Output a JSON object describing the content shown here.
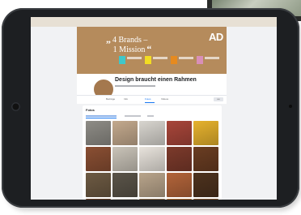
{
  "cover": {
    "quote_open": "„",
    "quote_close": "“",
    "line1": "4 Brands –",
    "line2": "1 Mission",
    "logo": "AD",
    "tiles": [
      {
        "color": "#3fc7c9"
      },
      {
        "color": "#f2dc22"
      },
      {
        "color": "#e68a1f"
      },
      {
        "color": "#d98fb8"
      }
    ]
  },
  "profile": {
    "name": "Design braucht einen Rahmen"
  },
  "tabs": [
    {
      "label": "Beiträge"
    },
    {
      "label": "Info"
    },
    {
      "label": "Fotos"
    },
    {
      "label": "Videos"
    }
  ],
  "more_button": "•••",
  "photos": {
    "title": "Fotos",
    "colors": [
      "#8e8c86",
      "#c3a98d",
      "#d8d5cf",
      "#a8463a",
      "#e6b22e",
      "#8a4f33",
      "#c9c3b8",
      "#e8e3dc",
      "#7c3a2b",
      "#6a3d22",
      "#6d5a43",
      "#5a5449",
      "#b8a48b",
      "#b2643a",
      "#4d321e",
      "#6e4429",
      "#e2dcd3",
      "#9b7a56",
      "#c27a38",
      "#8a5a32"
    ]
  }
}
